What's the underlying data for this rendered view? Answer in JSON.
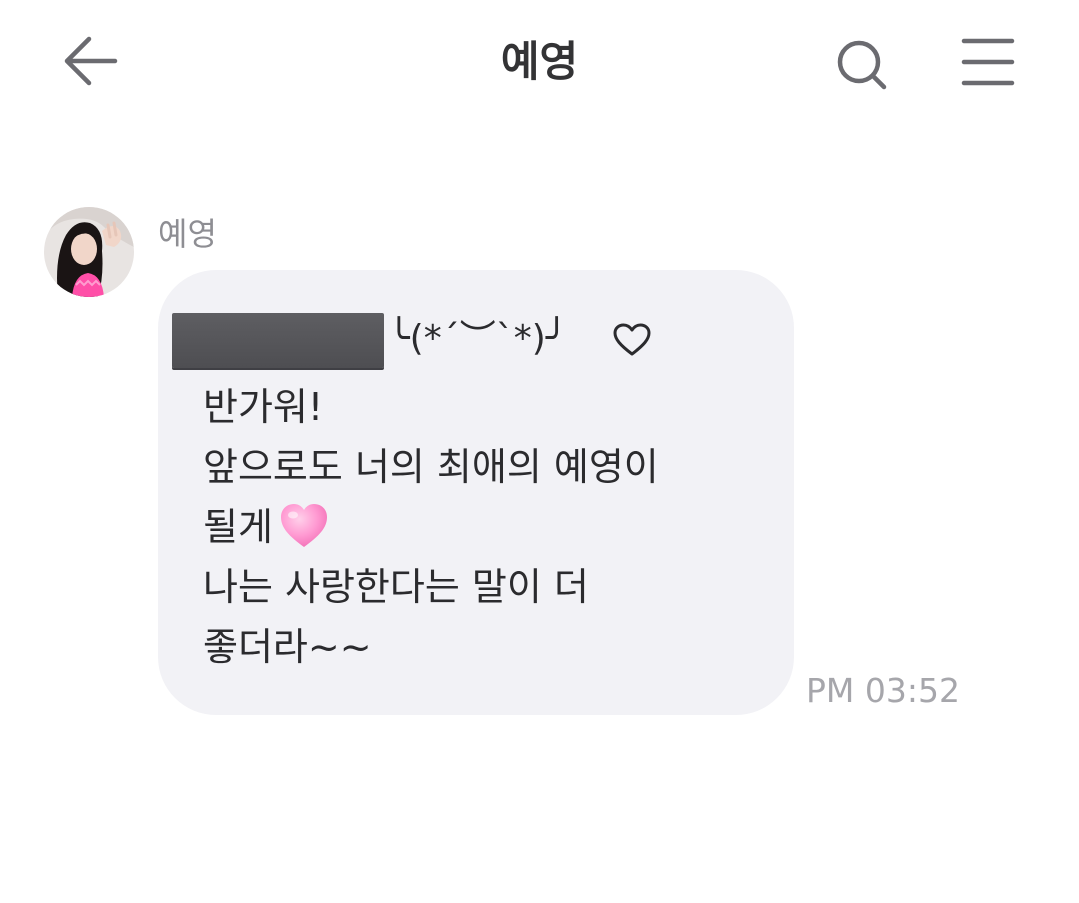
{
  "header": {
    "title": "예영",
    "back_icon": "arrow-left-icon",
    "search_icon": "search-icon",
    "menu_icon": "hamburger-menu-icon"
  },
  "message": {
    "sender": "예영",
    "kaomoji": "╰(*´︶`*)╯",
    "heart_symbol": "♡",
    "lines": [
      "반가워!",
      "앞으로도 너의 최애의 예영이",
      "될게",
      "나는 사랑한다는 말이 더",
      "좋더라~~"
    ],
    "emoji": "pink-heart-emoji",
    "timestamp": "PM 03:52"
  },
  "colors": {
    "bubble": "#f2f2f6",
    "text": "#2b2b2e",
    "sender_name": "#8e8e93",
    "timestamp": "#a6a6ab",
    "icon": "#6b6b70",
    "redaction": "#56565a",
    "heart_pink": "#ff8cc8"
  }
}
